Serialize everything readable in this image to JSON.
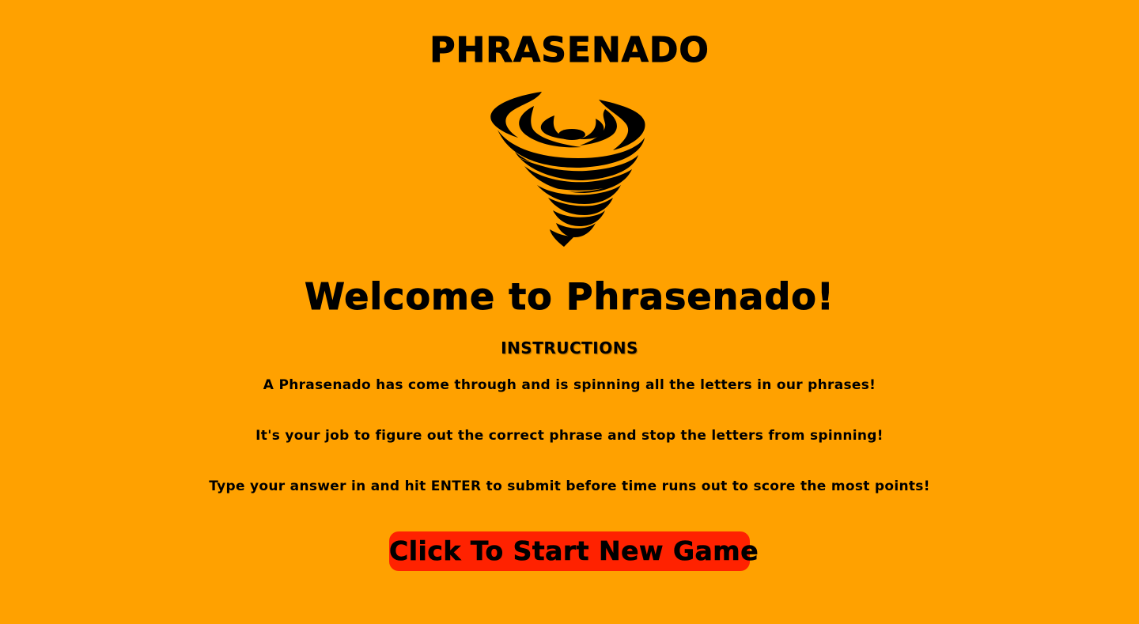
{
  "header": {
    "logo_text": "PHRASENADO",
    "logo_icon": "tornado-icon"
  },
  "main": {
    "welcome": "Welcome to Phrasenado!",
    "instructions_heading": "INSTRUCTIONS",
    "instructions": [
      "A Phrasenado has come through and is spinning all the letters in our phrases!",
      "It's your job to figure out the correct phrase and stop the letters from spinning!",
      "Type your answer in and hit ENTER to submit before time runs out to score the most points!"
    ],
    "start_button_label": "Click To Start New Game"
  },
  "colors": {
    "background": "#ffa100",
    "button": "#ff2200",
    "text": "#000000"
  }
}
